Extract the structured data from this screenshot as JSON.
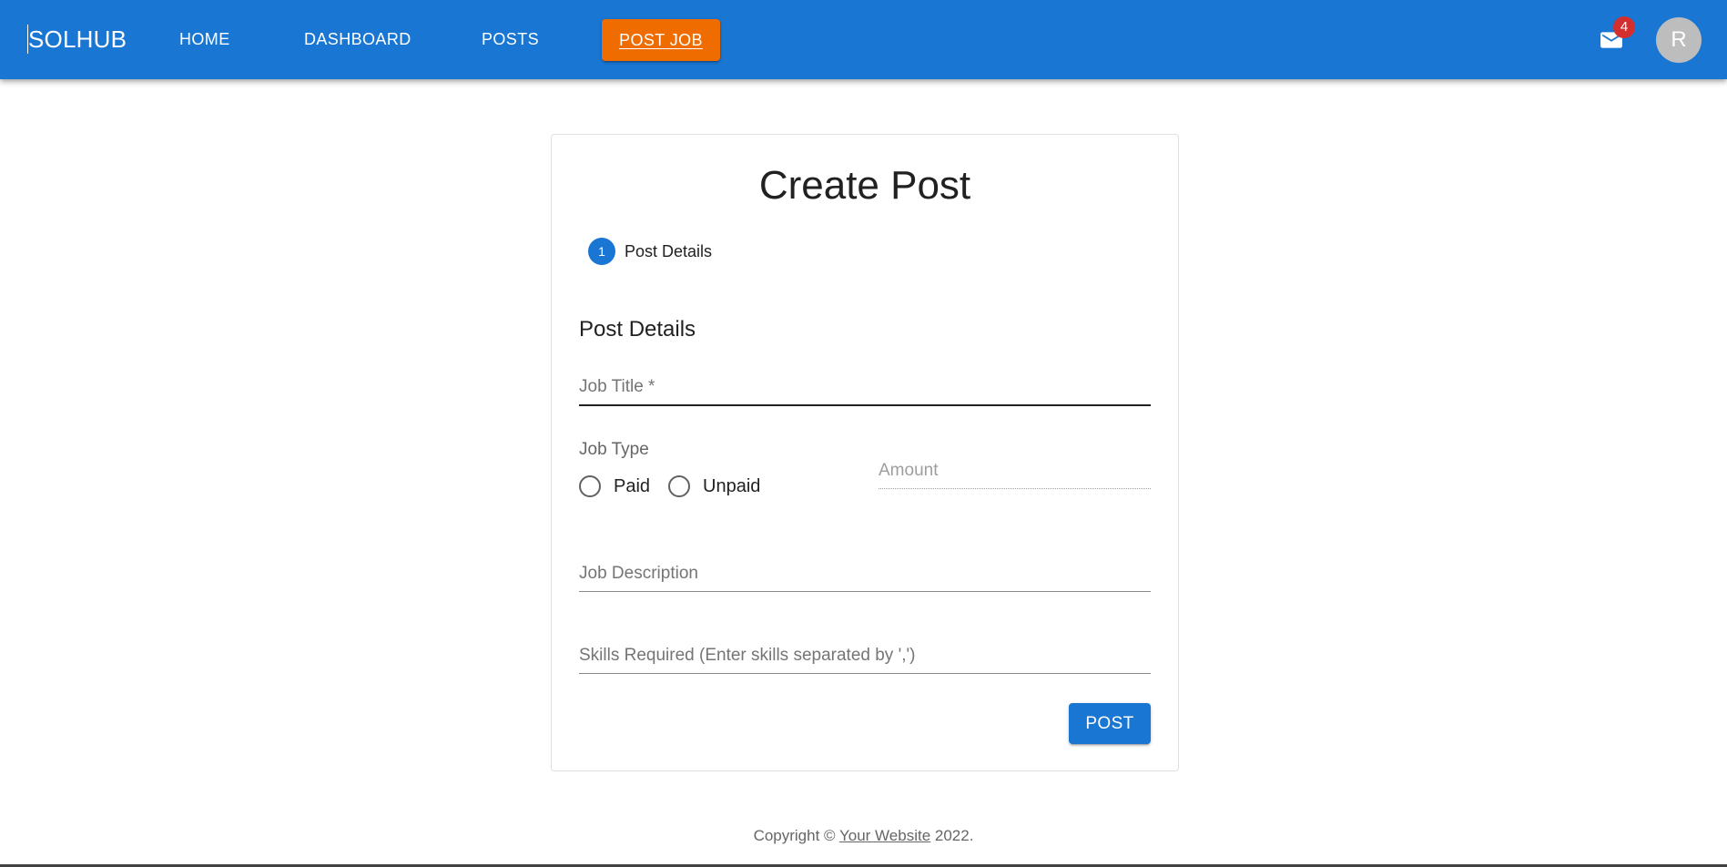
{
  "appbar": {
    "brand": "SOLHUB",
    "nav": {
      "home": "HOME",
      "dashboard": "DASHBOARD",
      "posts": "POSTS",
      "post_job": "POST JOB"
    },
    "mail_badge": "4",
    "avatar_initial": "R",
    "colors": {
      "bar": "#1976d2",
      "post_job": "#ef6c00",
      "badge": "#d32f2f"
    },
    "icons": {
      "mail": "mail-icon"
    }
  },
  "form": {
    "title": "Create Post",
    "stepper": {
      "number": "1",
      "label": "Post Details"
    },
    "section_title": "Post Details",
    "job_title": {
      "placeholder": "Job Title *",
      "value": ""
    },
    "job_type": {
      "label": "Job Type",
      "options": [
        "Paid",
        "Unpaid"
      ]
    },
    "amount": {
      "placeholder": "Amount",
      "value": ""
    },
    "job_description": {
      "placeholder": "Job Description",
      "value": ""
    },
    "skills": {
      "placeholder": "Skills Required (Enter skills separated by ',')",
      "value": ""
    },
    "submit_label": "POST"
  },
  "footer": {
    "prefix": "Copyright © ",
    "link": "Your Website",
    "suffix": " 2022."
  }
}
